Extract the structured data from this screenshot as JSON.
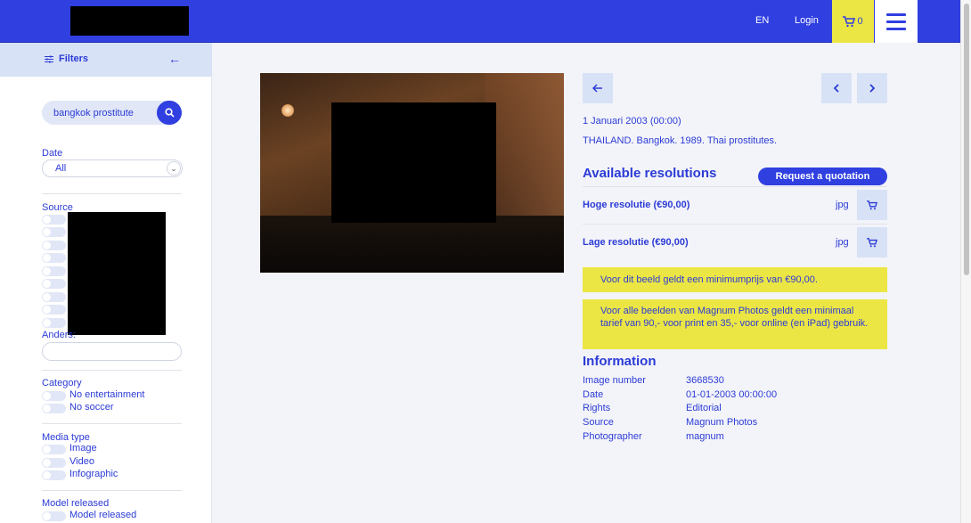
{
  "header": {
    "lang": "EN",
    "login": "Login",
    "cart_count": "0"
  },
  "sidebar": {
    "filters_label": "Filters",
    "search": {
      "value": "bangkok prostitute"
    },
    "date": {
      "title": "Date",
      "selected": "All"
    },
    "source": {
      "title": "Source",
      "other_label": "Anders:"
    },
    "category": {
      "title": "Category",
      "items": [
        "No entertainment",
        "No soccer"
      ]
    },
    "media_type": {
      "title": "Media type",
      "items": [
        "Image",
        "Video",
        "Infographic"
      ]
    },
    "model_released": {
      "title": "Model released",
      "items": [
        "Model released"
      ]
    }
  },
  "detail": {
    "date": "1 Januari 2003 (00:00)",
    "caption": "THAILAND. Bangkok. 1989. Thai prostitutes.",
    "resolutions_title": "Available resolutions",
    "quote_button": "Request a quotation",
    "resolutions": [
      {
        "label": "Hoge resolutie (€90,00)",
        "format": "jpg"
      },
      {
        "label": "Lage resolutie (€90,00)",
        "format": "jpg"
      }
    ],
    "notice_1": "Voor dit beeld geldt een minimumprijs van €90,00.",
    "notice_2": "Voor alle beelden van Magnum Photos geldt een minimaal tarief van 90,- voor print en 35,- voor online (en iPad) gebruik.",
    "info_title": "Information",
    "info": [
      {
        "key": "Image number",
        "value": "3668530"
      },
      {
        "key": "Date",
        "value": "01-01-2003 00:00:00"
      },
      {
        "key": "Rights",
        "value": "Editorial"
      },
      {
        "key": "Source",
        "value": "Magnum Photos"
      },
      {
        "key": "Photographer",
        "value": "magnum"
      }
    ]
  },
  "colors": {
    "brand_blue": "#2f3fe0",
    "accent_yellow": "#ece644",
    "light_blue": "#d8e2f6"
  }
}
